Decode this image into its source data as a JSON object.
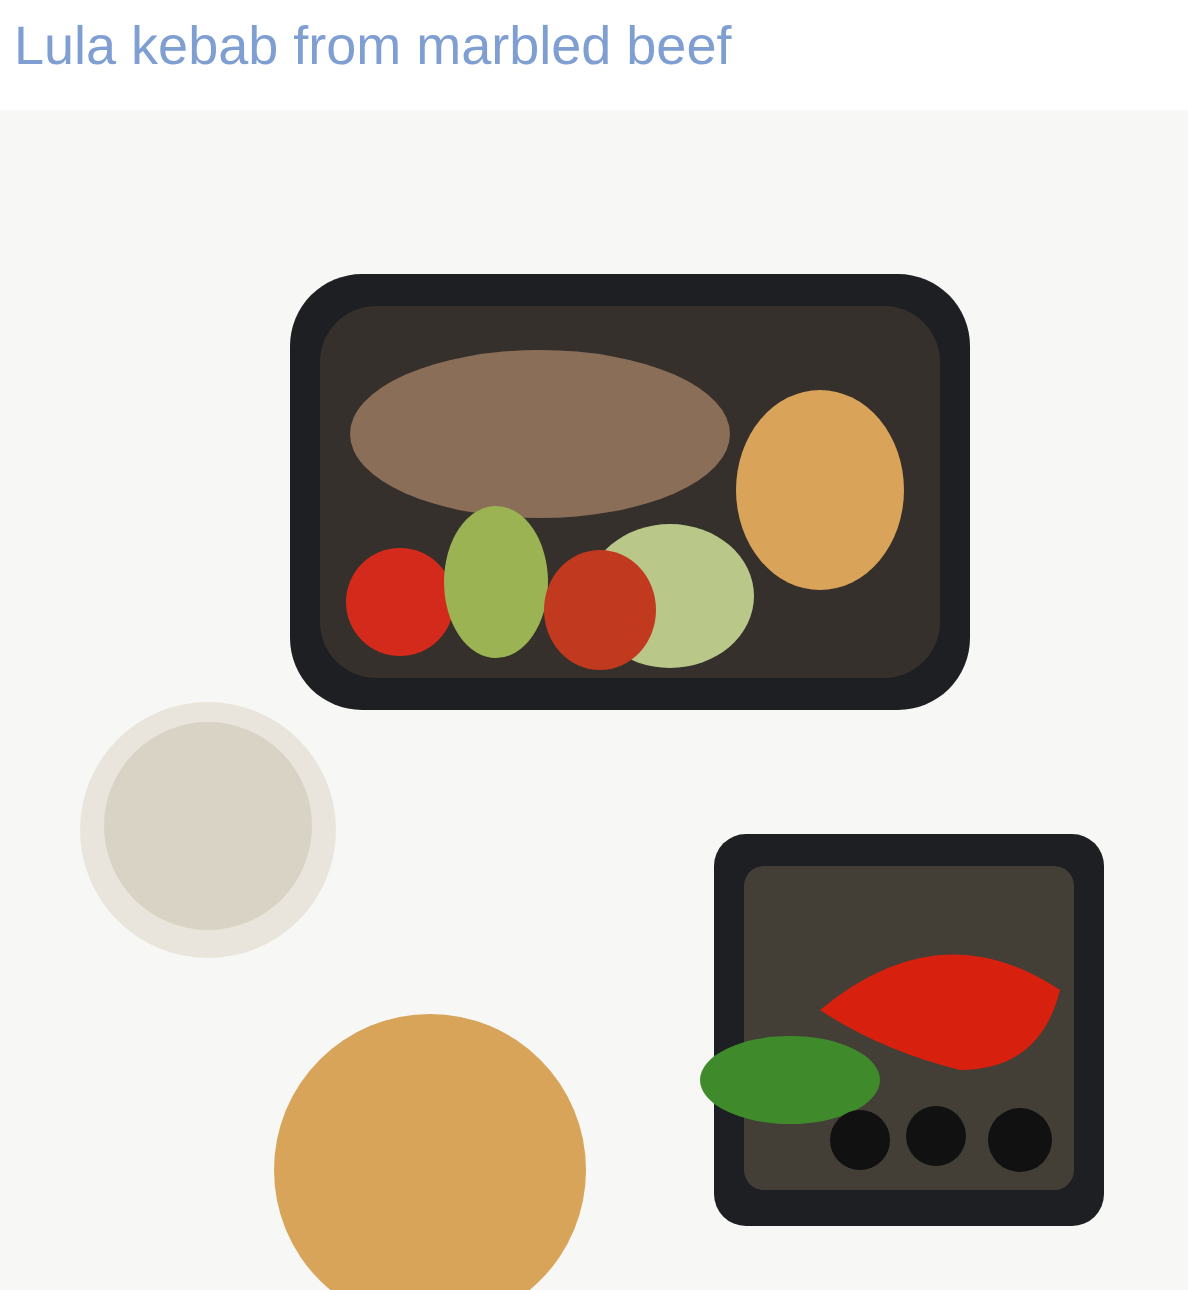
{
  "subtitle": "Lula kebab from marbled beef"
}
